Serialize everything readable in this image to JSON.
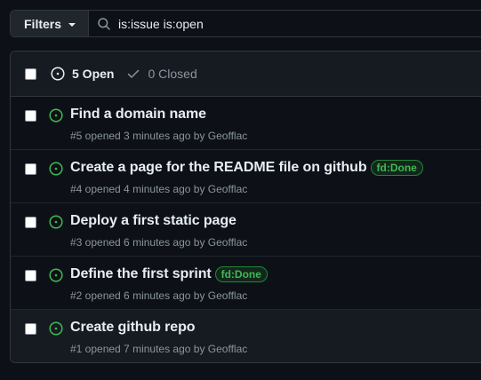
{
  "colors": {
    "open": "#3fb950",
    "muted": "#8b949e",
    "label_border": "#238636"
  },
  "filter_bar": {
    "filters_label": "Filters",
    "search_value": "is:issue is:open"
  },
  "header": {
    "open_label": "5 Open",
    "closed_label": "0 Closed"
  },
  "issues": [
    {
      "title": "Find a domain name",
      "label": "",
      "meta": "#5 opened 3 minutes ago by Geofflac"
    },
    {
      "title": "Create a page for the README file on github",
      "label": "fd:Done",
      "meta": "#4 opened 4 minutes ago by Geofflac"
    },
    {
      "title": "Deploy a first static page",
      "label": "",
      "meta": "#3 opened 6 minutes ago by Geofflac"
    },
    {
      "title": "Define the first sprint",
      "label": "fd:Done",
      "meta": "#2 opened 6 minutes ago by Geofflac"
    },
    {
      "title": "Create github repo",
      "label": "",
      "meta": "#1 opened 7 minutes ago by Geofflac"
    }
  ]
}
